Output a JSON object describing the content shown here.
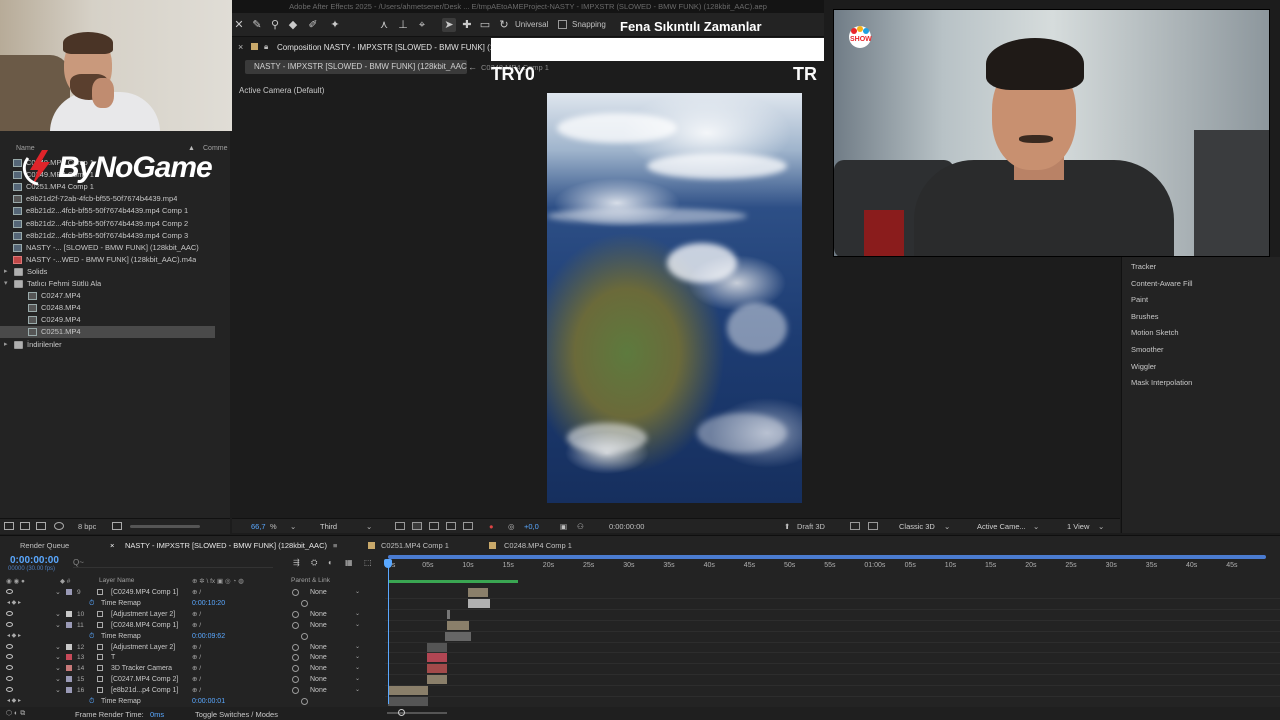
{
  "window": {
    "title": "Adobe After Effects 2025 - /Users/ahmetsener/Desk ... E/tmpAEtoAMEProject-NASTY - IMPXSTR (SLOWED - BMW FUNK) (128kbit_AAC).aep"
  },
  "toolbar": {
    "universal_label": "Universal",
    "snapping_label": "Snapping"
  },
  "overlay": {
    "news_banner": "Fena Sıkıntılı Zamanlar",
    "try0_text": "TRY0",
    "tr_text": "TR",
    "channel_logo": "SHOW",
    "brand_name": "ByNoGame"
  },
  "project": {
    "col_name": "Name",
    "col_comment": "Comme",
    "items": [
      {
        "label": "C0248.MP4 Comp 1",
        "type": "comp"
      },
      {
        "label": "C0249.MP4 Comp 1",
        "type": "comp"
      },
      {
        "label": "C0251.MP4 Comp 1",
        "type": "comp"
      },
      {
        "label": "e8b21d2f-72ab-4fcb-bf55-50f7674b4439.mp4",
        "type": "file"
      },
      {
        "label": "e8b21d2...4fcb-bf55-50f7674b4439.mp4 Comp 1",
        "type": "comp"
      },
      {
        "label": "e8b21d2...4fcb-bf55-50f7674b4439.mp4 Comp 2",
        "type": "comp"
      },
      {
        "label": "e8b21d2...4fcb-bf55-50f7674b4439.mp4 Comp 3",
        "type": "comp"
      },
      {
        "label": "NASTY -... [SLOWED - BMW FUNK] (128kbit_AAC)",
        "type": "comp"
      },
      {
        "label": "NASTY -...WED - BMW FUNK] (128kbit_AAC).m4a",
        "type": "audio"
      },
      {
        "label": "Solids",
        "type": "folder"
      },
      {
        "label": "Tatlıcı Fehmi Sütlü Ala",
        "type": "folder"
      },
      {
        "label": "C0247.MP4",
        "type": "file"
      },
      {
        "label": "C0248.MP4",
        "type": "file"
      },
      {
        "label": "C0249.MP4",
        "type": "file"
      },
      {
        "label": "C0251.MP4",
        "type": "file"
      },
      {
        "label": "İndirilenler",
        "type": "folder"
      }
    ],
    "footer_bpc": "8 bpc"
  },
  "composition": {
    "tab_label": "Composition NASTY - IMPXSTR [SLOWED - BMW FUNK] (128",
    "sub_tab_active": "NASTY - IMPXSTR [SLOWED - BMW FUNK] (128kbit_AAC)",
    "sub_tab_next": "C0248.MP4 Comp 1",
    "camera_label": "Active Camera (Default)",
    "zoom": "66,7",
    "zoom_unit": "%",
    "resolution": "Third",
    "exposure": "+0,0",
    "timecode": "0:00:00:00",
    "renderer": "Draft 3D",
    "renderer_mode": "Classic 3D",
    "view_camera": "Active Came...",
    "view_layout": "1 View"
  },
  "right_panel": {
    "items": [
      "Tracker",
      "Content-Aware Fill",
      "Paint",
      "Brushes",
      "Motion Sketch",
      "Smoother",
      "Wiggler",
      "Mask Interpolation"
    ]
  },
  "timeline": {
    "tabs": [
      "Render Queue",
      "NASTY - IMPXSTR [SLOWED - BMW FUNK] (128kbit_AAC)",
      "C0251.MP4 Comp 1",
      "C0248.MP4 Comp 1"
    ],
    "current_time": "0:00:00:00",
    "fps": "00000 (30.00 fps)",
    "search_placeholder": "Q~",
    "col_layer_name": "Layer Name",
    "col_parent": "Parent & Link",
    "ruler": [
      "0s",
      "05s",
      "10s",
      "15s",
      "20s",
      "25s",
      "30s",
      "35s",
      "40s",
      "45s",
      "50s",
      "55s",
      "01:00s",
      "05s",
      "10s",
      "15s",
      "20s",
      "25s",
      "30s",
      "35s",
      "40s",
      "45s"
    ],
    "layers": [
      {
        "num": "9",
        "name": "[C0249.MP4 Comp 1]",
        "parent": "None",
        "color": "#9a9ab6",
        "kind": "layer"
      },
      {
        "num": "",
        "name": "Time Remap",
        "value": "0:00:10:20",
        "kind": "sub"
      },
      {
        "num": "10",
        "name": "[Adjustment Layer 2]",
        "parent": "None",
        "color": "#c8c8c8",
        "kind": "layer"
      },
      {
        "num": "11",
        "name": "[C0248.MP4 Comp 1]",
        "parent": "None",
        "color": "#9a9ab6",
        "kind": "layer"
      },
      {
        "num": "",
        "name": "Time Remap",
        "value": "0:00:09:62",
        "kind": "sub"
      },
      {
        "num": "12",
        "name": "[Adjustment Layer 2]",
        "parent": "None",
        "color": "#c8c8c8",
        "kind": "layer"
      },
      {
        "num": "13",
        "name": "T",
        "parent": "None",
        "color": "#c84a5a",
        "kind": "layer"
      },
      {
        "num": "14",
        "name": "3D Tracker Camera",
        "parent": "None",
        "color": "#c87a7a",
        "kind": "layer"
      },
      {
        "num": "15",
        "name": "[C0247.MP4 Comp 2]",
        "parent": "None",
        "color": "#9a9ab6",
        "kind": "layer"
      },
      {
        "num": "16",
        "name": "[e8b21d...p4 Comp 1]",
        "parent": "None",
        "color": "#9a9ab6",
        "kind": "layer"
      },
      {
        "num": "",
        "name": "Time Remap",
        "value": "0:00:00:01",
        "kind": "sub"
      }
    ],
    "footer_frame_render": "Frame Render Time:",
    "footer_frame_value": "0ms",
    "footer_toggle": "Toggle Switches / Modes"
  }
}
